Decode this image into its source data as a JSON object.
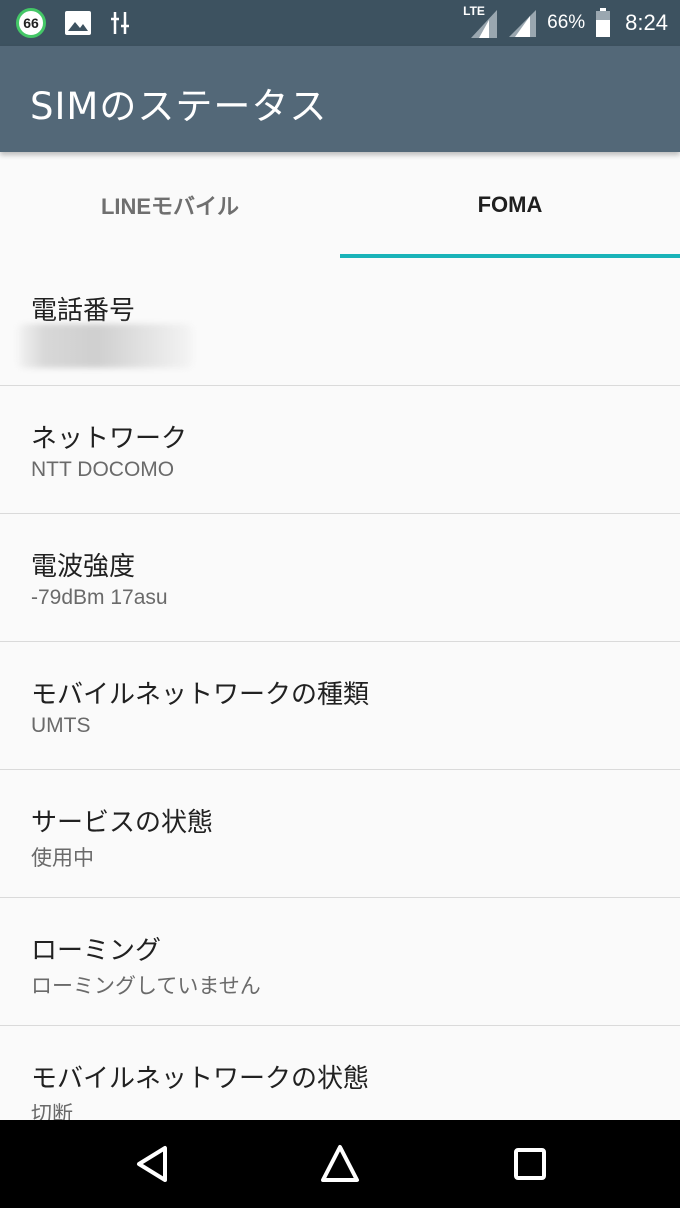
{
  "status_bar": {
    "notification_badge": "66",
    "network_label": "LTE",
    "battery_percent": "66%",
    "time": "8:24",
    "icons": [
      "badge-66-icon",
      "image-icon",
      "usb-debug-icon",
      "lte-signal-icon",
      "signal-icon",
      "battery-icon"
    ]
  },
  "app_bar": {
    "title": "SIMのステータス"
  },
  "tabs": [
    {
      "label": "LINEモバイル",
      "selected": false
    },
    {
      "label": "FOMA",
      "selected": true
    }
  ],
  "accent_color": "#19b3b8",
  "items": [
    {
      "title": "電話番号",
      "value": ""
    },
    {
      "title": "ネットワーク",
      "value": "NTT DOCOMO"
    },
    {
      "title": "電波強度",
      "value": "-79dBm 17asu"
    },
    {
      "title": "モバイルネットワークの種類",
      "value": "UMTS"
    },
    {
      "title": "サービスの状態",
      "value": "使用中"
    },
    {
      "title": "ローミング",
      "value": "ローミングしていません"
    },
    {
      "title": "モバイルネットワークの状態",
      "value": "切断"
    }
  ],
  "nav_bar": {
    "buttons": [
      "back-icon",
      "home-icon",
      "recents-icon"
    ]
  }
}
